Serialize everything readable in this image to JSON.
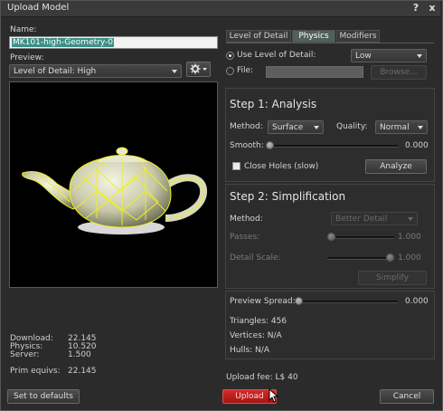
{
  "window": {
    "title": "Upload Model",
    "help_glyph": "?",
    "close_glyph": "x"
  },
  "left": {
    "name_label": "Name:",
    "name_value": "MK101-high-Geometry-0",
    "preview_label": "Preview:",
    "preview_select": "Level of Detail: High",
    "stats": {
      "download_label": "Download:",
      "download_value": "22.145",
      "physics_label": "Physics:",
      "physics_value": "10.520",
      "server_label": "Server:",
      "server_value": "1.500",
      "prim_label": "Prim equivs:",
      "prim_value": "22.145"
    },
    "defaults_button": "Set to defaults"
  },
  "tabs": [
    {
      "label": "Level of Detail",
      "active": false
    },
    {
      "label": "Physics",
      "active": true
    },
    {
      "label": "Modifiers",
      "active": false
    }
  ],
  "physics_source": {
    "use_lod_label": "Use Level of Detail:",
    "use_lod_value": "Low",
    "file_label": "File:",
    "browse_button": "Browse..."
  },
  "analysis": {
    "title": "Step 1: Analysis",
    "method_label": "Method:",
    "method_value": "Surface",
    "quality_label": "Quality:",
    "quality_value": "Normal",
    "smooth_label": "Smooth:",
    "smooth_value": "0.000",
    "smooth_fraction": 0.0,
    "close_holes_label": "Close Holes (slow)",
    "analyze_button": "Analyze"
  },
  "simplification": {
    "title": "Step 2: Simplification",
    "method_label": "Method:",
    "method_value": "Better Detail",
    "passes_label": "Passes:",
    "passes_value": "1.000",
    "passes_fraction": 0.0,
    "detail_scale_label": "Detail Scale:",
    "detail_scale_value": "1.000",
    "detail_scale_fraction": 1.0,
    "simplify_button": "Simplify"
  },
  "results": {
    "preview_spread_label": "Preview Spread:",
    "preview_spread_value": "0.000",
    "preview_spread_fraction": 0.0,
    "triangles": "Triangles: 456",
    "vertices": "Vertices: N/A",
    "hulls": "Hulls: N/A"
  },
  "footer": {
    "upload_fee": "Upload fee: L$ 40",
    "upload_button": "Upload",
    "cancel_button": "Cancel"
  },
  "colors": {
    "accent_upload": "#c41e1e",
    "name_selection": "#3d8f86",
    "active_tab": "#51605b",
    "wireframe": "#f0f020"
  }
}
